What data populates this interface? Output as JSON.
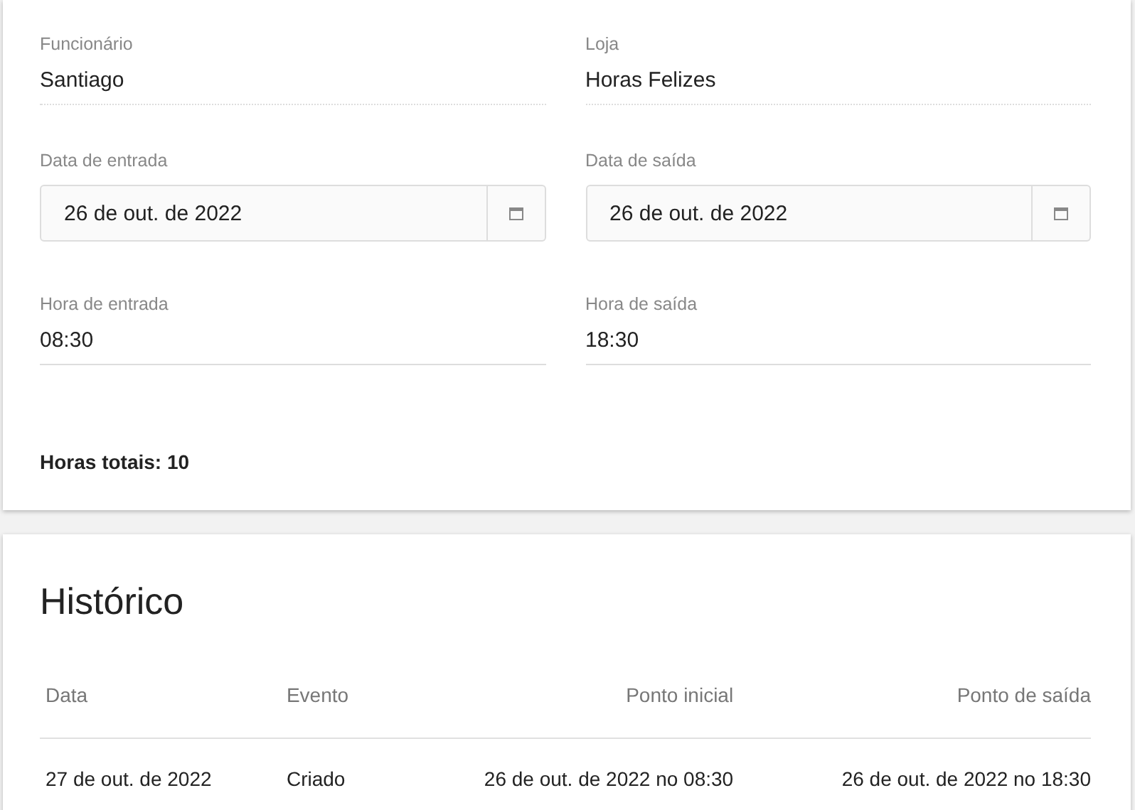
{
  "form": {
    "fields": [
      {
        "kind": "readonly",
        "label": "Funcionário",
        "value": "Santiago"
      },
      {
        "kind": "readonly",
        "label": "Loja",
        "value": "Horas Felizes"
      },
      {
        "kind": "date",
        "label": "Data de entrada",
        "value": "26 de out. de 2022"
      },
      {
        "kind": "date",
        "label": "Data de saída",
        "value": "26 de out. de 2022"
      },
      {
        "kind": "time",
        "label": "Hora de entrada",
        "value": "08:30"
      },
      {
        "kind": "time",
        "label": "Hora de saída",
        "value": "18:30"
      }
    ],
    "total": "Horas totais: 10"
  },
  "history": {
    "title": "Histórico",
    "columns": [
      "Data",
      "Evento",
      "Ponto inicial",
      "Ponto de saída"
    ],
    "rows": [
      [
        "27 de out. de 2022",
        "Criado",
        "26 de out. de 2022 no 08:30",
        "26 de out. de 2022 no 18:30"
      ]
    ]
  }
}
